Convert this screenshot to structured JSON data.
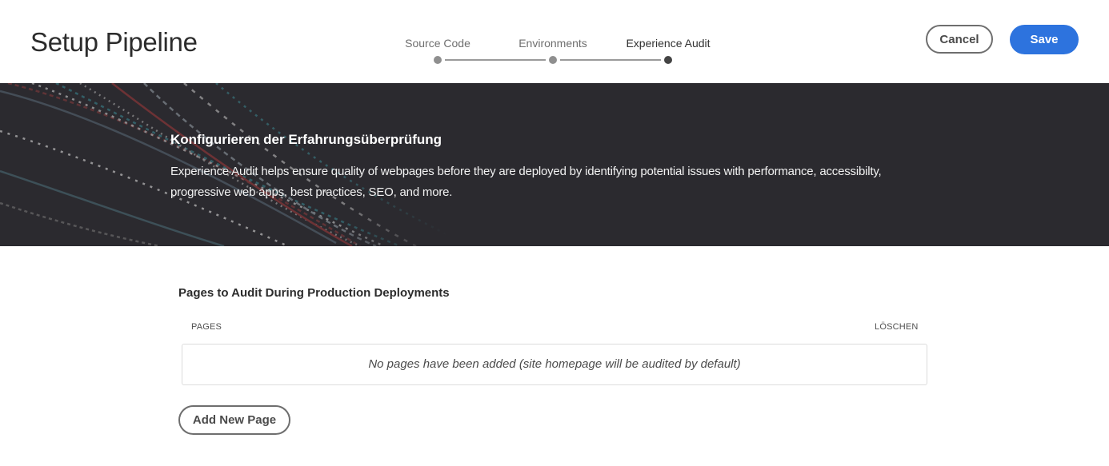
{
  "header": {
    "title": "Setup Pipeline",
    "steps": [
      {
        "label": "Source Code",
        "state": "completed"
      },
      {
        "label": "Environments",
        "state": "completed"
      },
      {
        "label": "Experience Audit",
        "state": "current"
      }
    ],
    "cancel_label": "Cancel",
    "save_label": "Save"
  },
  "banner": {
    "title": "Konfigurieren der Erfahrungsüberprüfung",
    "description": "Experience Audit helps ensure quality of webpages before they are deployed by identifying potential issues with performance, accessibilty, progressive web apps, best practices, SEO, and more."
  },
  "audit": {
    "section_title": "Pages to Audit During Production Deployments",
    "columns": {
      "pages": "PAGES",
      "delete": "LÖSCHEN"
    },
    "empty_message": "No pages have been added (site homepage will be audited by default)",
    "add_button_label": "Add New Page"
  },
  "colors": {
    "primary": "#2d73de",
    "banner_bg": "#2b2a2f",
    "text": "#2c2c2c"
  }
}
